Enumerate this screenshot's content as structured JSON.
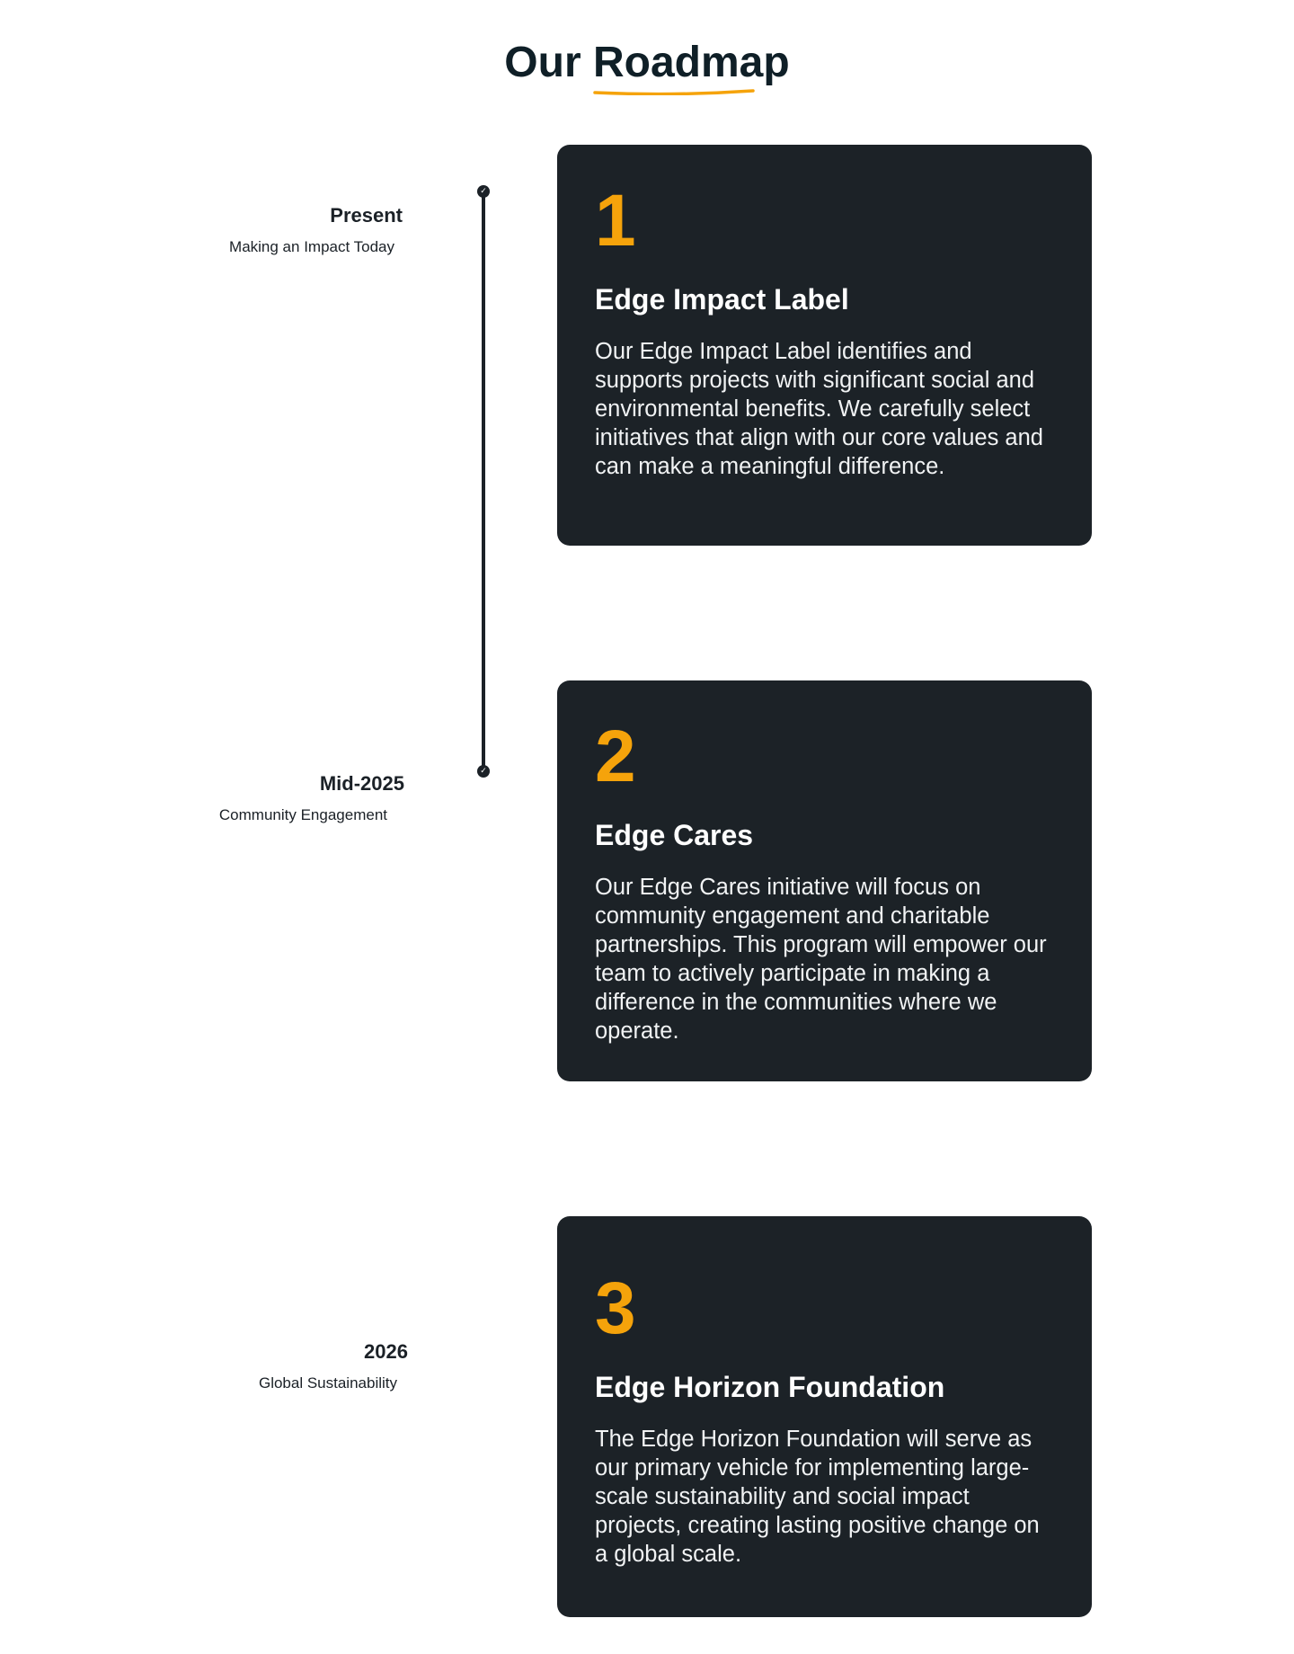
{
  "heading": {
    "prefix": "Our",
    "highlight": "Roadmap",
    "underline_color": "#f5a30b"
  },
  "timeline": {
    "node_icon": "check-icon",
    "node_glyph": "✓",
    "milestones": [
      {
        "date": "Present",
        "caption": "Making an Impact Today"
      },
      {
        "date": "Mid-2025",
        "caption": "Community Engagement"
      },
      {
        "date": "2026",
        "caption": "Global Sustainability"
      }
    ]
  },
  "cards": [
    {
      "number": "1",
      "title": "Edge Impact Label",
      "text": "Our Edge Impact Label identifies and supports projects with significant social and environmental benefits. We carefully select initiatives that align with our core values and can make a meaningful difference."
    },
    {
      "number": "2",
      "title": "Edge Cares",
      "text": "Our Edge Cares initiative will focus on community engagement and charitable partnerships. This program will empower our team to actively participate in making a difference in the communities where we operate."
    },
    {
      "number": "3",
      "title": "Edge Horizon Foundation",
      "text": "The Edge Horizon Foundation will serve as our primary vehicle for implementing large-scale sustainability and social impact projects, creating lasting positive change on a global scale."
    }
  ],
  "colors": {
    "accent": "#f5a30b",
    "card_background": "#1c2227",
    "heading": "#0f1f27",
    "text_dark": "#1b2127"
  }
}
